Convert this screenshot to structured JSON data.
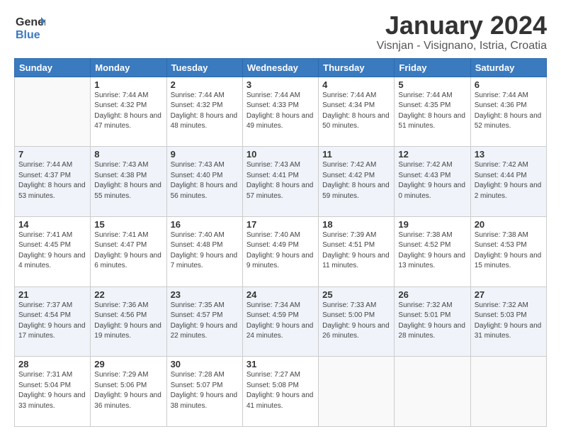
{
  "header": {
    "logo_general": "General",
    "logo_blue": "Blue",
    "month": "January 2024",
    "location": "Visnjan - Visignano, Istria, Croatia"
  },
  "weekdays": [
    "Sunday",
    "Monday",
    "Tuesday",
    "Wednesday",
    "Thursday",
    "Friday",
    "Saturday"
  ],
  "weeks": [
    [
      {
        "day": "",
        "sunrise": "",
        "sunset": "",
        "daylight": ""
      },
      {
        "day": "1",
        "sunrise": "Sunrise: 7:44 AM",
        "sunset": "Sunset: 4:32 PM",
        "daylight": "Daylight: 8 hours and 47 minutes."
      },
      {
        "day": "2",
        "sunrise": "Sunrise: 7:44 AM",
        "sunset": "Sunset: 4:32 PM",
        "daylight": "Daylight: 8 hours and 48 minutes."
      },
      {
        "day": "3",
        "sunrise": "Sunrise: 7:44 AM",
        "sunset": "Sunset: 4:33 PM",
        "daylight": "Daylight: 8 hours and 49 minutes."
      },
      {
        "day": "4",
        "sunrise": "Sunrise: 7:44 AM",
        "sunset": "Sunset: 4:34 PM",
        "daylight": "Daylight: 8 hours and 50 minutes."
      },
      {
        "day": "5",
        "sunrise": "Sunrise: 7:44 AM",
        "sunset": "Sunset: 4:35 PM",
        "daylight": "Daylight: 8 hours and 51 minutes."
      },
      {
        "day": "6",
        "sunrise": "Sunrise: 7:44 AM",
        "sunset": "Sunset: 4:36 PM",
        "daylight": "Daylight: 8 hours and 52 minutes."
      }
    ],
    [
      {
        "day": "7",
        "sunrise": "Sunrise: 7:44 AM",
        "sunset": "Sunset: 4:37 PM",
        "daylight": "Daylight: 8 hours and 53 minutes."
      },
      {
        "day": "8",
        "sunrise": "Sunrise: 7:43 AM",
        "sunset": "Sunset: 4:38 PM",
        "daylight": "Daylight: 8 hours and 55 minutes."
      },
      {
        "day": "9",
        "sunrise": "Sunrise: 7:43 AM",
        "sunset": "Sunset: 4:40 PM",
        "daylight": "Daylight: 8 hours and 56 minutes."
      },
      {
        "day": "10",
        "sunrise": "Sunrise: 7:43 AM",
        "sunset": "Sunset: 4:41 PM",
        "daylight": "Daylight: 8 hours and 57 minutes."
      },
      {
        "day": "11",
        "sunrise": "Sunrise: 7:42 AM",
        "sunset": "Sunset: 4:42 PM",
        "daylight": "Daylight: 8 hours and 59 minutes."
      },
      {
        "day": "12",
        "sunrise": "Sunrise: 7:42 AM",
        "sunset": "Sunset: 4:43 PM",
        "daylight": "Daylight: 9 hours and 0 minutes."
      },
      {
        "day": "13",
        "sunrise": "Sunrise: 7:42 AM",
        "sunset": "Sunset: 4:44 PM",
        "daylight": "Daylight: 9 hours and 2 minutes."
      }
    ],
    [
      {
        "day": "14",
        "sunrise": "Sunrise: 7:41 AM",
        "sunset": "Sunset: 4:45 PM",
        "daylight": "Daylight: 9 hours and 4 minutes."
      },
      {
        "day": "15",
        "sunrise": "Sunrise: 7:41 AM",
        "sunset": "Sunset: 4:47 PM",
        "daylight": "Daylight: 9 hours and 6 minutes."
      },
      {
        "day": "16",
        "sunrise": "Sunrise: 7:40 AM",
        "sunset": "Sunset: 4:48 PM",
        "daylight": "Daylight: 9 hours and 7 minutes."
      },
      {
        "day": "17",
        "sunrise": "Sunrise: 7:40 AM",
        "sunset": "Sunset: 4:49 PM",
        "daylight": "Daylight: 9 hours and 9 minutes."
      },
      {
        "day": "18",
        "sunrise": "Sunrise: 7:39 AM",
        "sunset": "Sunset: 4:51 PM",
        "daylight": "Daylight: 9 hours and 11 minutes."
      },
      {
        "day": "19",
        "sunrise": "Sunrise: 7:38 AM",
        "sunset": "Sunset: 4:52 PM",
        "daylight": "Daylight: 9 hours and 13 minutes."
      },
      {
        "day": "20",
        "sunrise": "Sunrise: 7:38 AM",
        "sunset": "Sunset: 4:53 PM",
        "daylight": "Daylight: 9 hours and 15 minutes."
      }
    ],
    [
      {
        "day": "21",
        "sunrise": "Sunrise: 7:37 AM",
        "sunset": "Sunset: 4:54 PM",
        "daylight": "Daylight: 9 hours and 17 minutes."
      },
      {
        "day": "22",
        "sunrise": "Sunrise: 7:36 AM",
        "sunset": "Sunset: 4:56 PM",
        "daylight": "Daylight: 9 hours and 19 minutes."
      },
      {
        "day": "23",
        "sunrise": "Sunrise: 7:35 AM",
        "sunset": "Sunset: 4:57 PM",
        "daylight": "Daylight: 9 hours and 22 minutes."
      },
      {
        "day": "24",
        "sunrise": "Sunrise: 7:34 AM",
        "sunset": "Sunset: 4:59 PM",
        "daylight": "Daylight: 9 hours and 24 minutes."
      },
      {
        "day": "25",
        "sunrise": "Sunrise: 7:33 AM",
        "sunset": "Sunset: 5:00 PM",
        "daylight": "Daylight: 9 hours and 26 minutes."
      },
      {
        "day": "26",
        "sunrise": "Sunrise: 7:32 AM",
        "sunset": "Sunset: 5:01 PM",
        "daylight": "Daylight: 9 hours and 28 minutes."
      },
      {
        "day": "27",
        "sunrise": "Sunrise: 7:32 AM",
        "sunset": "Sunset: 5:03 PM",
        "daylight": "Daylight: 9 hours and 31 minutes."
      }
    ],
    [
      {
        "day": "28",
        "sunrise": "Sunrise: 7:31 AM",
        "sunset": "Sunset: 5:04 PM",
        "daylight": "Daylight: 9 hours and 33 minutes."
      },
      {
        "day": "29",
        "sunrise": "Sunrise: 7:29 AM",
        "sunset": "Sunset: 5:06 PM",
        "daylight": "Daylight: 9 hours and 36 minutes."
      },
      {
        "day": "30",
        "sunrise": "Sunrise: 7:28 AM",
        "sunset": "Sunset: 5:07 PM",
        "daylight": "Daylight: 9 hours and 38 minutes."
      },
      {
        "day": "31",
        "sunrise": "Sunrise: 7:27 AM",
        "sunset": "Sunset: 5:08 PM",
        "daylight": "Daylight: 9 hours and 41 minutes."
      },
      {
        "day": "",
        "sunrise": "",
        "sunset": "",
        "daylight": ""
      },
      {
        "day": "",
        "sunrise": "",
        "sunset": "",
        "daylight": ""
      },
      {
        "day": "",
        "sunrise": "",
        "sunset": "",
        "daylight": ""
      }
    ]
  ]
}
